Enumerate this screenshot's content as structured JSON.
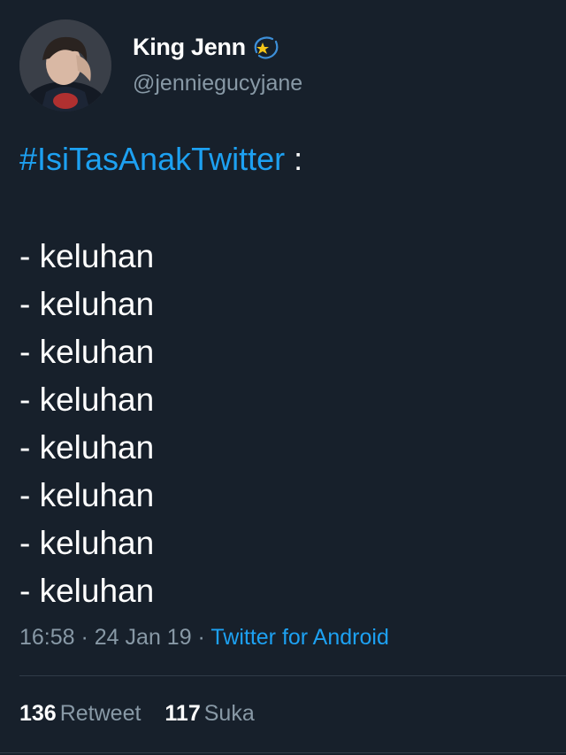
{
  "author": {
    "display_name": "King Jenn",
    "name_emoji": "dizzy-icon",
    "handle": "@jenniegucyjane"
  },
  "tweet": {
    "hashtag": "#IsiTasAnakTwitter",
    "after_hashtag": " :",
    "items": [
      "- keluhan",
      "- keluhan",
      "- keluhan",
      "- keluhan",
      "- keluhan",
      "- keluhan",
      "- keluhan",
      "- keluhan"
    ]
  },
  "meta": {
    "time": "16:58",
    "sep1": " · ",
    "date": "24 Jan 19",
    "sep2": " · ",
    "source": "Twitter for Android"
  },
  "stats": {
    "retweets_count": "136",
    "retweets_label": "Retweet",
    "likes_count": "117",
    "likes_label": "Suka"
  },
  "colors": {
    "background": "#17202b",
    "link": "#1da1f2",
    "secondary_text": "#8899a6",
    "primary_text": "#ffffff"
  }
}
